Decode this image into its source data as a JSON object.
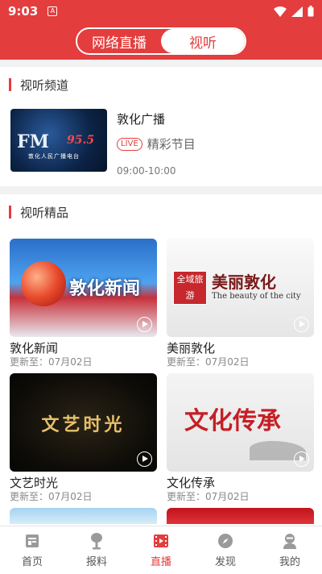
{
  "status_bar": {
    "time": "9:03",
    "app_icon": "A"
  },
  "header": {
    "tabs": [
      {
        "label": "网络直播",
        "active": false
      },
      {
        "label": "视听",
        "active": true
      }
    ]
  },
  "channels": {
    "title": "视听频道",
    "item": {
      "name": "敦化广播",
      "badge": "LIVE",
      "program": "精彩节目",
      "time": "09:00-10:00",
      "thumb_fm": "FM",
      "thumb_freq": "95.5",
      "thumb_sub": "敦化人民广播电台"
    }
  },
  "featured": {
    "title": "视听精品",
    "items": [
      {
        "title": "敦化新闻",
        "update": "更新至：07月02日",
        "thumb_text": "敦化新闻"
      },
      {
        "title": "美丽敦化",
        "update": "更新至：07月02日",
        "thumb_text": "美丽敦化",
        "thumb_badge": "全域旅游",
        "thumb_eng": "The beauty of the city"
      },
      {
        "title": "文艺时光",
        "update": "更新至：07月02日",
        "thumb_text": "文艺时光"
      },
      {
        "title": "文化传承",
        "update": "更新至：07月02日",
        "thumb_text": "文化传承"
      }
    ]
  },
  "tabbar": {
    "items": [
      {
        "label": "首页",
        "icon": "home-icon"
      },
      {
        "label": "报料",
        "icon": "microphone-icon"
      },
      {
        "label": "直播",
        "icon": "film-icon",
        "active": true
      },
      {
        "label": "发现",
        "icon": "compass-icon"
      },
      {
        "label": "我的",
        "icon": "profile-icon"
      }
    ]
  },
  "colors": {
    "brand": "#e43d3d"
  }
}
